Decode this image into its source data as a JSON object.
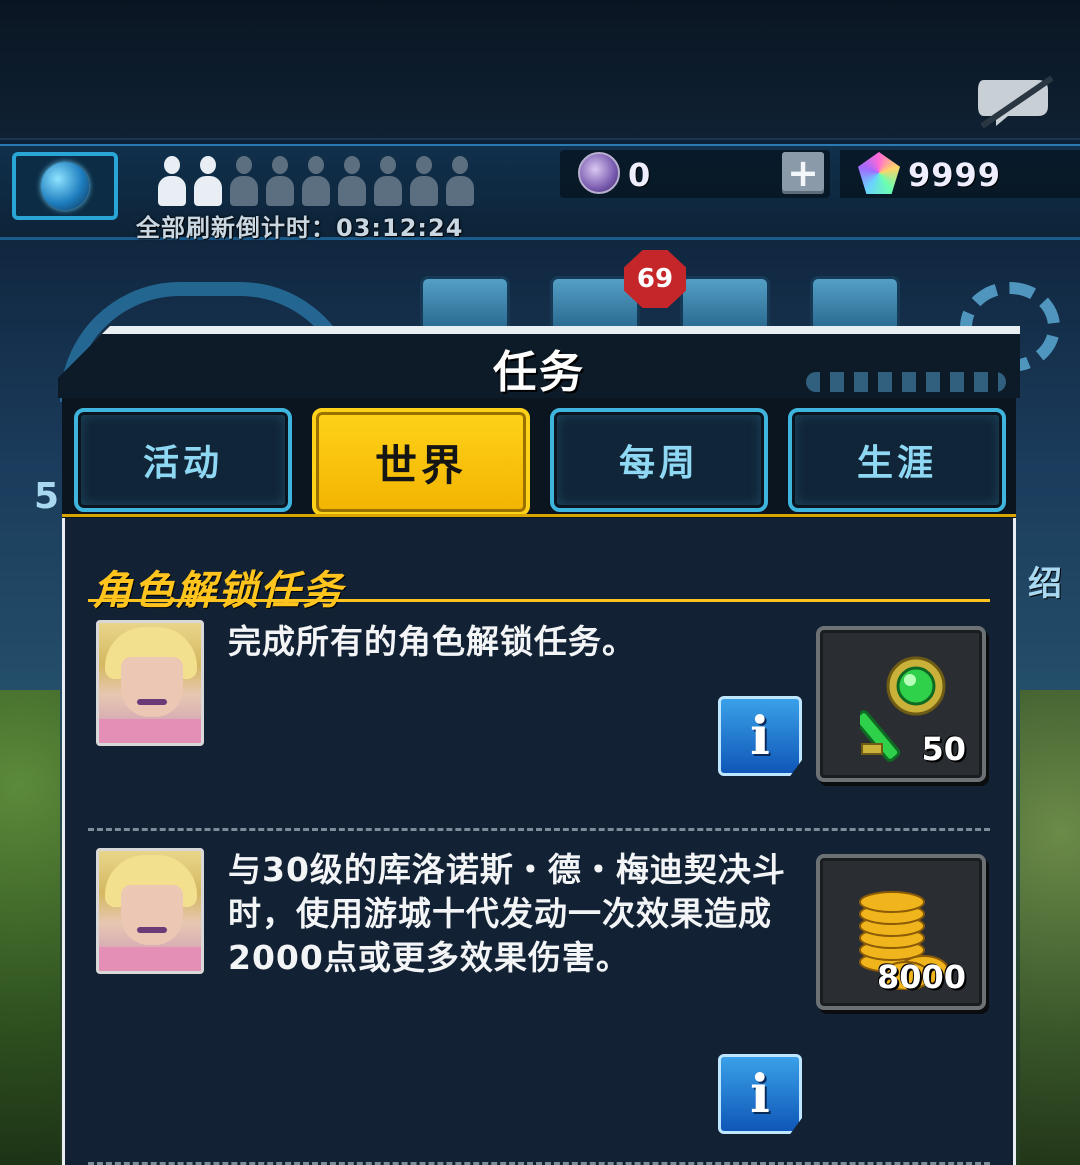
{
  "hud": {
    "refresh_timer": "全部刷新倒计时：03:12:24",
    "orb_count": "0",
    "gem_count": "9999",
    "plus_label": "+",
    "notification_badge": "69",
    "side_label_right": "绍",
    "side_label_left": "5",
    "lit_people": 2,
    "total_people": 9
  },
  "dialog": {
    "title": "任务",
    "tabs": [
      {
        "label": "活动",
        "active": false
      },
      {
        "label": "世界",
        "active": true
      },
      {
        "label": "每周",
        "active": false
      },
      {
        "label": "生涯",
        "active": false
      }
    ],
    "section_title": "角色解锁任务",
    "quests": [
      {
        "text": "完成所有的角色解锁任务。",
        "reward_icon": "key-icon",
        "reward_count": "50",
        "info_label": "i"
      },
      {
        "text": "与30级的库洛诺斯・德・梅迪契决斗时，使用游城十代发动一次效果造成2000点或更多效果伤害。",
        "reward_icon": "gold-coins-icon",
        "reward_count": "8000",
        "info_label": "i"
      }
    ]
  },
  "colors": {
    "accent_yellow": "#ffc51e",
    "tab_border": "#3fb5de",
    "panel_bg": "#122234"
  }
}
